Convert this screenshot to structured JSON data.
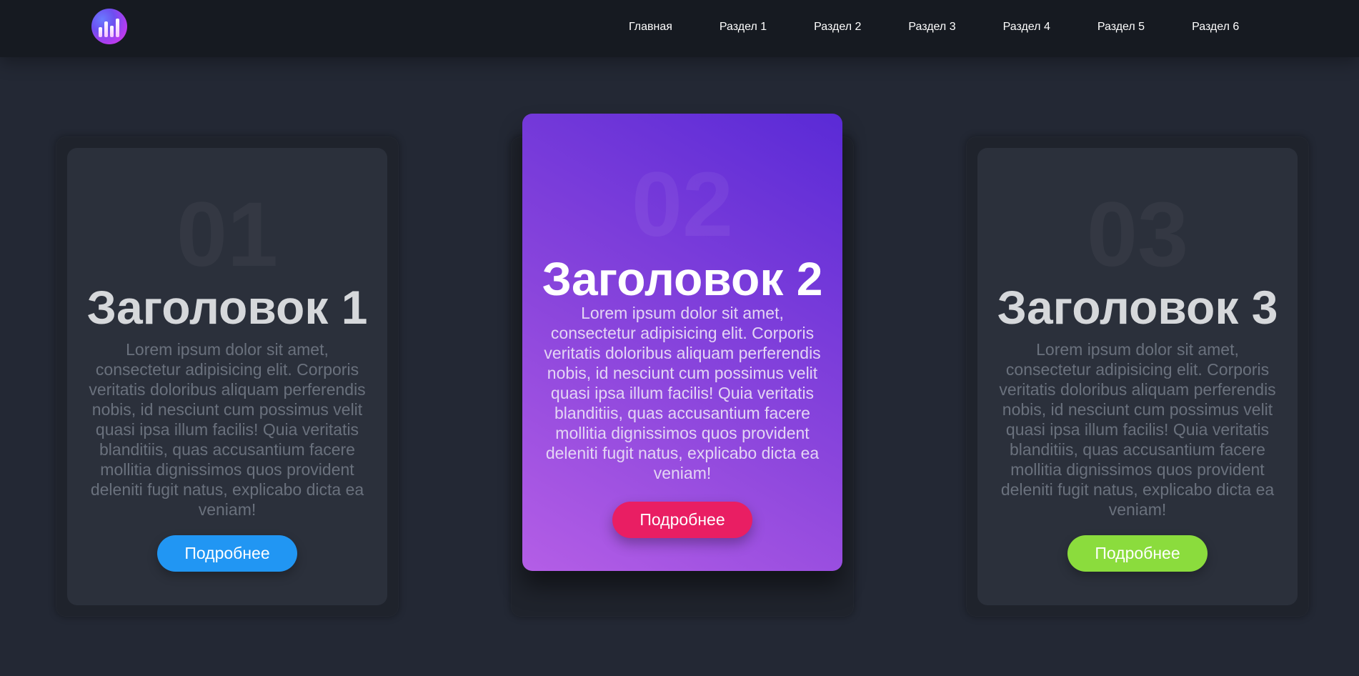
{
  "header": {
    "nav": [
      "Главная",
      "Раздел 1",
      "Раздел 2",
      "Раздел 3",
      "Раздел 4",
      "Раздел 5",
      "Раздел 6"
    ]
  },
  "cards": [
    {
      "number": "01",
      "title": "Заголовок 1",
      "text": "Lorem ipsum dolor sit amet, consectetur adipisicing elit. Corporis veritatis doloribus aliquam perferendis nobis, id nesciunt cum possimus velit quasi ipsa illum facilis! Quia veritatis blanditiis, quas accusantium facere mollitia dignissimos quos provident deleniti fugit natus, explicabo dicta ea veniam!",
      "button": "Подробнее",
      "button_color": "#2196f3"
    },
    {
      "number": "02",
      "title": "Заголовок 2",
      "text": "Lorem ipsum dolor sit amet, consectetur adipisicing elit. Corporis veritatis doloribus aliquam perferendis nobis, id nesciunt cum possimus velit quasi ipsa illum facilis! Quia veritatis blanditiis, quas accusantium facere mollitia dignissimos quos provident deleniti fugit natus, explicabo dicta ea veniam!",
      "button": "Подробнее",
      "button_color": "#e91e63"
    },
    {
      "number": "03",
      "title": "Заголовок 3",
      "text": "Lorem ipsum dolor sit amet, consectetur adipisicing elit. Corporis veritatis doloribus aliquam perferendis nobis, id nesciunt cum possimus velit quasi ipsa illum facilis! Quia veritatis blanditiis, quas accusantium facere mollitia dignissimos quos provident deleniti fugit natus, explicabo dicta ea veniam!",
      "button": "Подробнее",
      "button_color": "#8bdc3d"
    }
  ],
  "colors": {
    "background": "#232834",
    "header": "#161a21",
    "card": "#2b303b",
    "featured_gradient_start": "#b45ee6",
    "featured_gradient_end": "#5a2ad6"
  },
  "icons": {
    "logo": "bar-chart-logo-icon"
  }
}
